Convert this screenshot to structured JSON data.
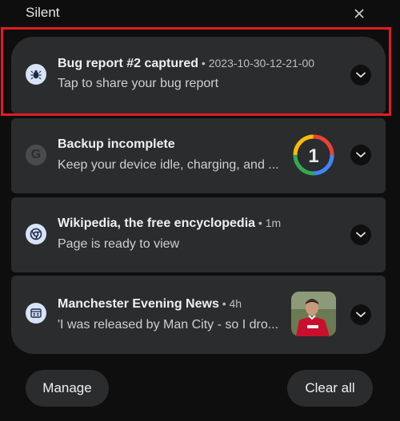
{
  "header": {
    "title": "Silent",
    "close_icon": "close-icon"
  },
  "notifications": [
    {
      "app_icon": "bug-icon",
      "title": "Bug report #2 captured",
      "meta": " • 2023-10-30-12-21-00",
      "body": "Tap to share your bug report",
      "expand_icon": "chevron-down-icon"
    },
    {
      "app_icon": "google-g-icon",
      "title": "Backup incomplete",
      "meta": "",
      "body": "Keep your device idle, charging, and ...",
      "thumbnail": "google-one-logo",
      "thumbnail_text": "1",
      "expand_icon": "chevron-down-icon"
    },
    {
      "app_icon": "chrome-icon",
      "title": "Wikipedia, the free encyclopedia",
      "meta": " • 1m",
      "body": "Page is ready to view",
      "expand_icon": "chevron-down-icon"
    },
    {
      "app_icon": "news-icon",
      "title": "Manchester Evening News",
      "meta": " • 4h",
      "body": "'I was released by Man City - so I dro...",
      "thumbnail": "football-player-photo",
      "expand_icon": "chevron-down-icon"
    }
  ],
  "footer": {
    "manage_label": "Manage",
    "clear_all_label": "Clear all"
  },
  "colors": {
    "card_bg": "#2b2c2e",
    "highlight": "#e31b23",
    "background": "#0e0e0e"
  }
}
